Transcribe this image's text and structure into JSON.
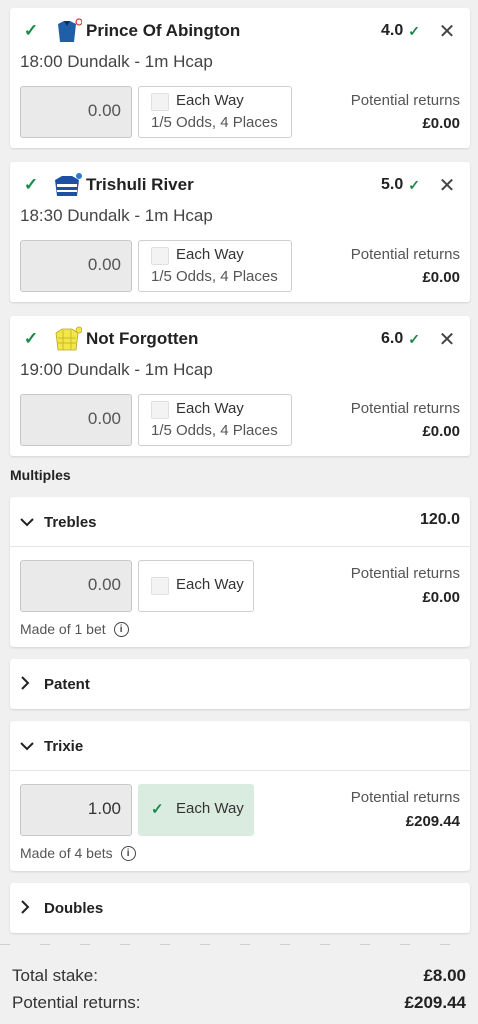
{
  "selections": [
    {
      "name": "Prince Of Abington",
      "odds": "4.0",
      "race": "18:00 Dundalk - 1m Hcap",
      "stake": "0.00",
      "each_way": "Each Way",
      "ew_terms": "1/5 Odds, 4 Places",
      "returns_label": "Potential returns",
      "returns": "£0.00",
      "silks": "blue-silks-icon"
    },
    {
      "name": "Trishuli River",
      "odds": "5.0",
      "race": "18:30 Dundalk - 1m Hcap",
      "stake": "0.00",
      "each_way": "Each Way",
      "ew_terms": "1/5 Odds, 4 Places",
      "returns_label": "Potential returns",
      "returns": "£0.00",
      "silks": "navy-silks-icon"
    },
    {
      "name": "Not Forgotten",
      "odds": "6.0",
      "race": "19:00 Dundalk - 1m Hcap",
      "stake": "0.00",
      "each_way": "Each Way",
      "ew_terms": "1/5 Odds, 4 Places",
      "returns_label": "Potential returns",
      "returns": "£0.00",
      "silks": "yellow-silks-icon"
    }
  ],
  "multiples_title": "Multiples",
  "trebles": {
    "label": "Trebles",
    "odds": "120.0",
    "stake": "0.00",
    "each_way": "Each Way",
    "returns_label": "Potential returns",
    "returns": "£0.00",
    "made_of": "Made of 1 bet"
  },
  "patent": {
    "label": "Patent"
  },
  "trixie": {
    "label": "Trixie",
    "stake": "1.00",
    "each_way": "Each Way",
    "returns_label": "Potential returns",
    "returns": "£209.44",
    "made_of": "Made of 4 bets"
  },
  "doubles": {
    "label": "Doubles"
  },
  "totals": {
    "stake_label": "Total stake:",
    "stake": "£8.00",
    "returns_label": "Potential returns:",
    "returns": "£209.44"
  },
  "colors": {
    "accent_green": "#1a8a4a",
    "ew_checked_bg": "#d9ecdf"
  }
}
